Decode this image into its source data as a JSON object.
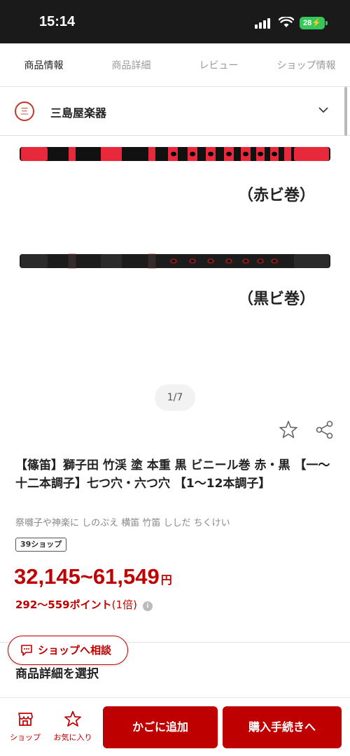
{
  "status_bar": {
    "time": "15:14",
    "battery": "28"
  },
  "tabs": [
    {
      "label": "商品情報",
      "active": true
    },
    {
      "label": "商品詳細",
      "active": false
    },
    {
      "label": "レビュー",
      "active": false
    },
    {
      "label": "ショップ情報",
      "active": false
    }
  ],
  "shop": {
    "logo_text": "三",
    "name": "三島屋楽器"
  },
  "gallery": {
    "caption_red": "（赤ビ巻）",
    "caption_black": "（黒ビ巻）",
    "pager": "1/7"
  },
  "product": {
    "title": "【篠笛】獅子田 竹渓 塗 本重 黒 ビニール巻 赤・黒 【一〜十二本調子】七つ穴・六つ穴 【1〜12本調子】",
    "keywords": "祭囃子や神楽に しのぶえ 横笛 竹笛 ししだ ちくけい",
    "shop_count": "39ショップ",
    "price": "32,145~61,549",
    "price_unit": "円",
    "points": "292〜559ポイント",
    "points_multiplier": "(1倍)",
    "info_icon_text": "i"
  },
  "consult_button": "ショップへ相談",
  "select_detail": "商品詳細を選択",
  "bottom_bar": {
    "shop_label": "ショップ",
    "favorite_label": "お気に入り",
    "cart_label": "かごに追加",
    "buy_label": "購入手続きへ"
  },
  "colors": {
    "accent": "#bf0000",
    "flute_red": "#e8293b"
  },
  "icons": [
    "signal-icon",
    "wifi-icon",
    "chevron-down-icon",
    "star-icon",
    "share-icon",
    "chat-icon",
    "store-icon"
  ]
}
